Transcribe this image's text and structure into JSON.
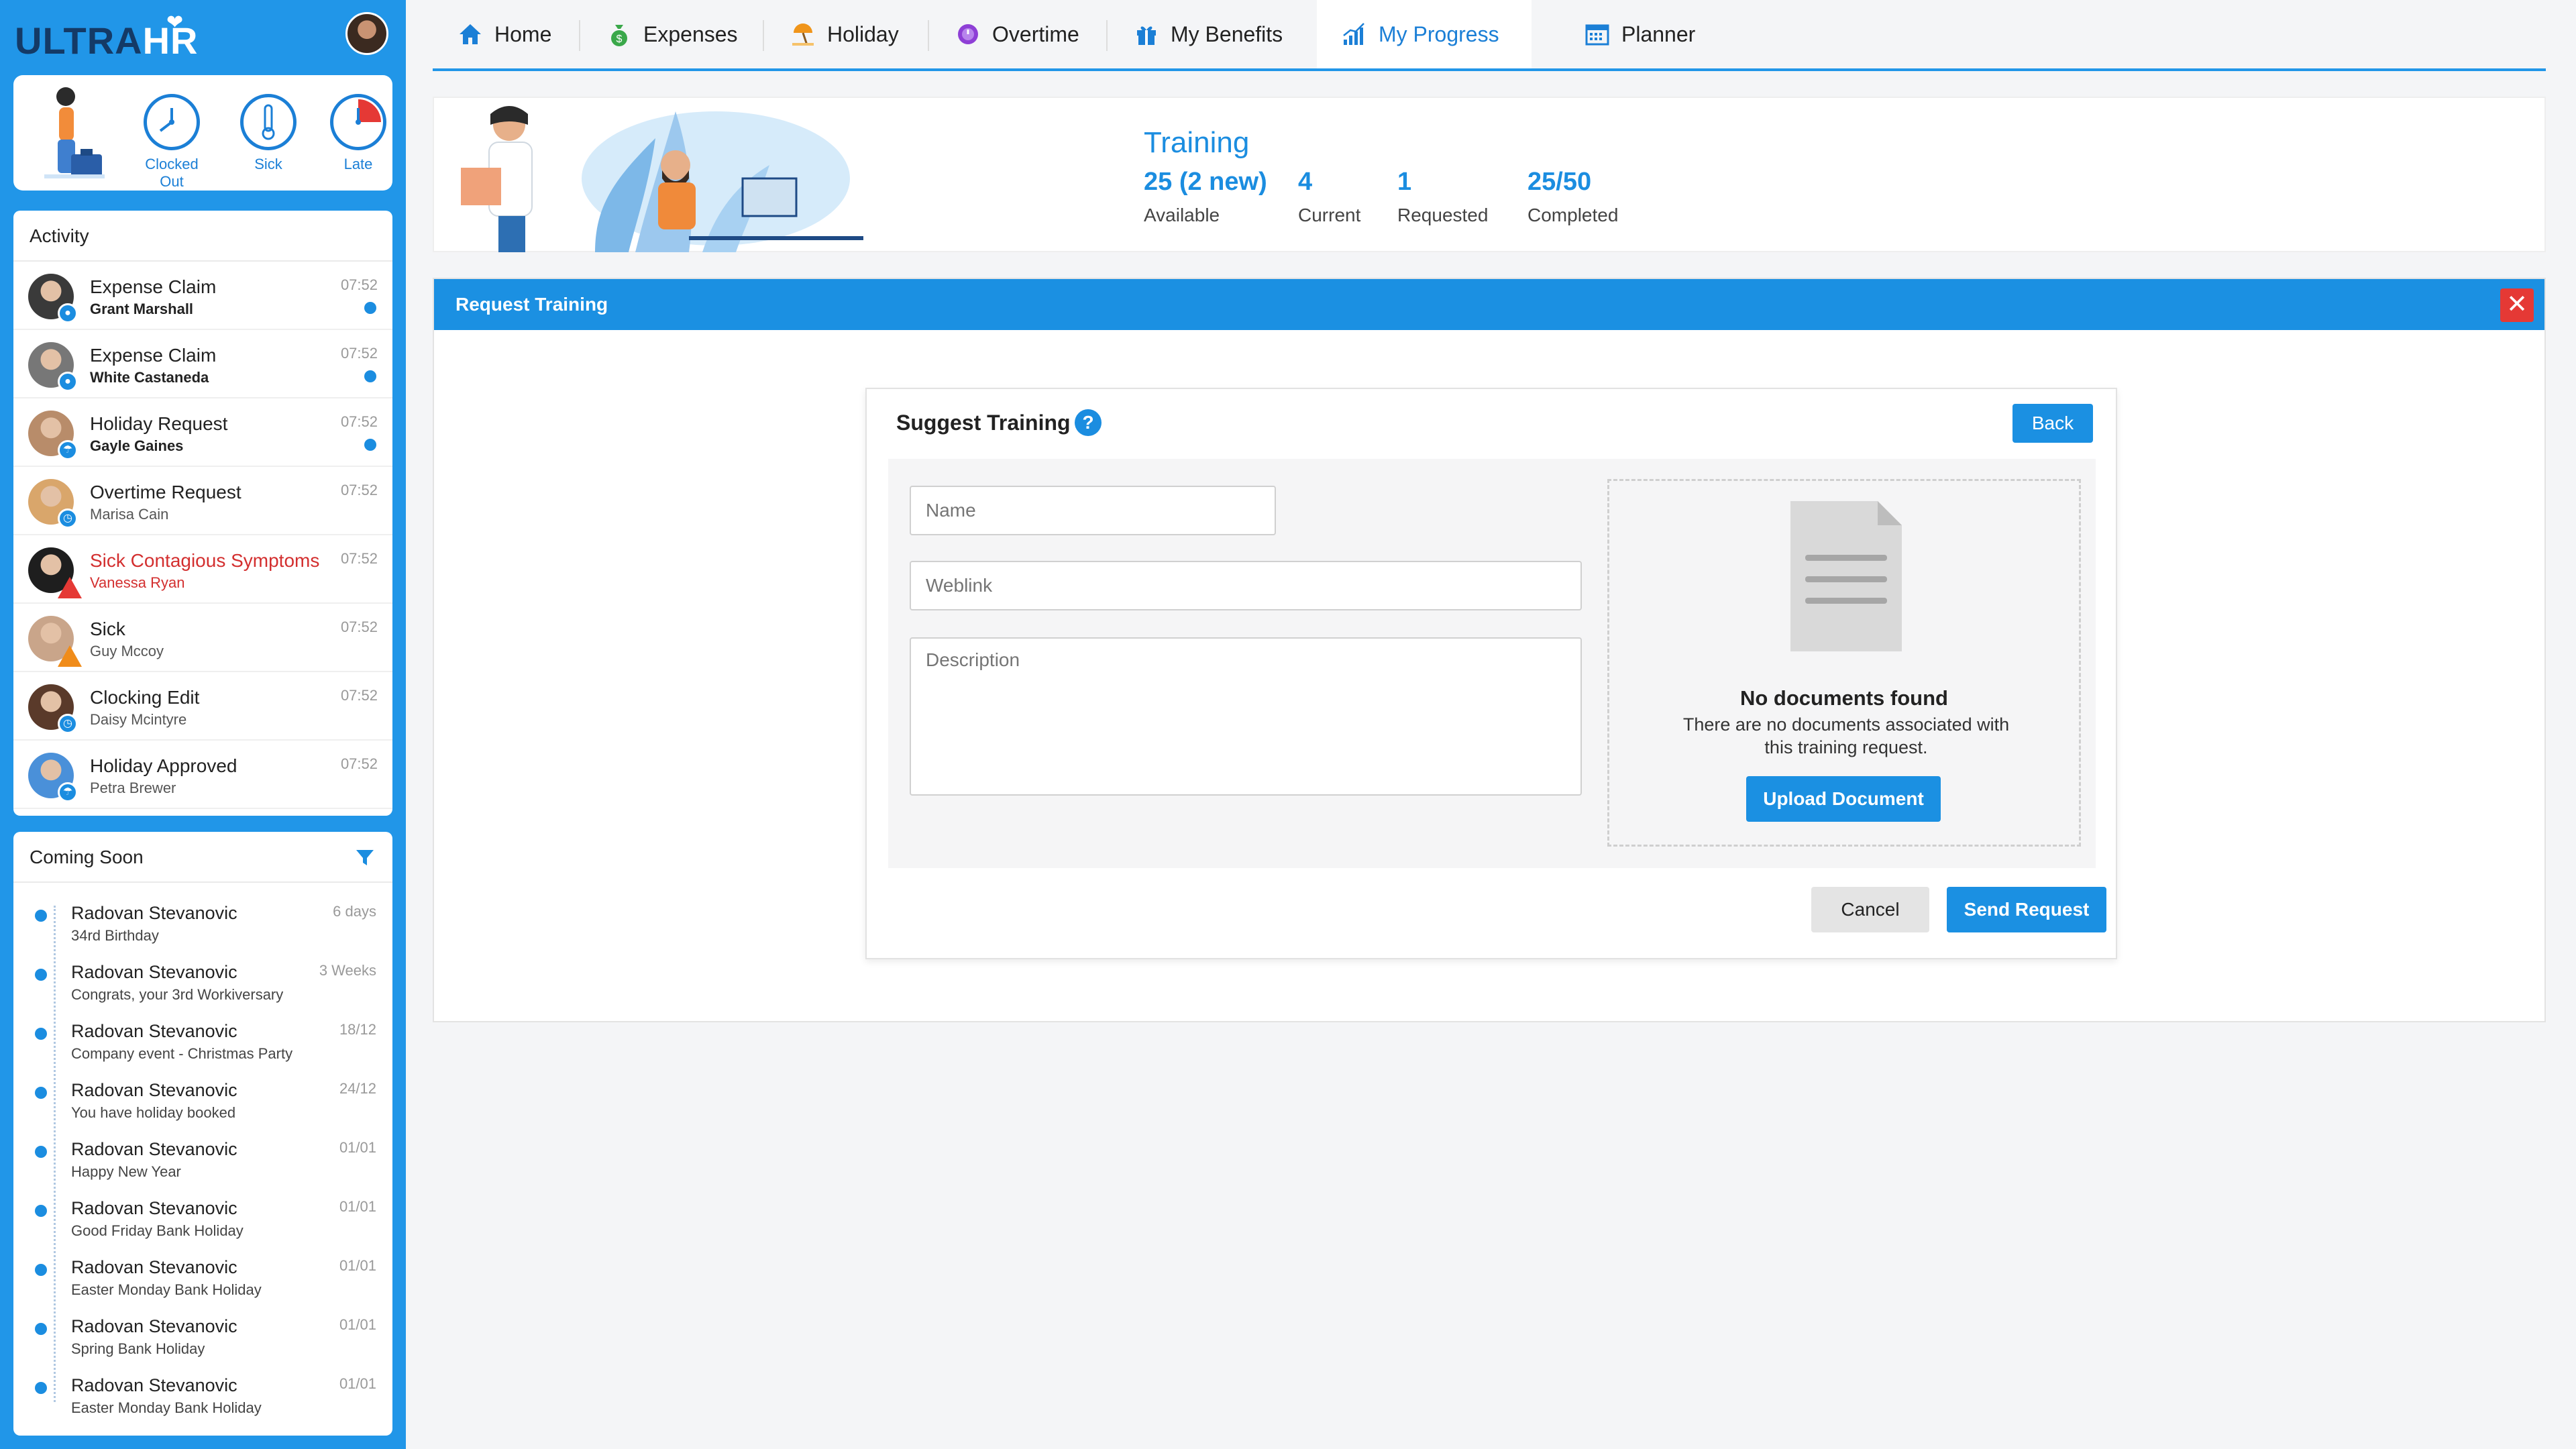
{
  "brand": {
    "ultra": "ULTRA",
    "hr": "HR"
  },
  "status": {
    "clocked_out": "Clocked Out",
    "sick": "Sick",
    "late": "Late"
  },
  "activity": {
    "title": "Activity",
    "items": [
      {
        "title": "Expense Claim",
        "person": "Grant Marshall",
        "time": "07:52",
        "unread": true,
        "badge": "expense-icon",
        "avatar_color": "#3a3a3a",
        "bold_sub": true
      },
      {
        "title": "Expense Claim",
        "person": "White Castaneda",
        "time": "07:52",
        "unread": true,
        "badge": "expense-icon",
        "avatar_color": "#777777",
        "bold_sub": true
      },
      {
        "title": "Holiday Request",
        "person": "Gayle Gaines",
        "time": "07:52",
        "unread": true,
        "badge": "holiday-icon",
        "avatar_color": "#b88c6a",
        "bold_sub": true
      },
      {
        "title": "Overtime Request",
        "person": "Marisa Cain",
        "time": "07:52",
        "unread": false,
        "badge": "clock-icon",
        "avatar_color": "#d9a66b",
        "bold_sub": false
      },
      {
        "title": "Sick Contagious Symptoms",
        "person": "Vanessa Ryan",
        "time": "07:52",
        "unread": false,
        "badge": "warning-icon",
        "avatar_color": "#1e1e1e",
        "bold_sub": false,
        "alert": true
      },
      {
        "title": "Sick",
        "person": "Guy Mccoy",
        "time": "07:52",
        "unread": false,
        "badge": "warning-icon",
        "avatar_color": "#c9a58a",
        "bold_sub": false
      },
      {
        "title": "Clocking Edit",
        "person": "Daisy Mcintyre",
        "time": "07:52",
        "unread": false,
        "badge": "clock-icon",
        "avatar_color": "#5a3a2a",
        "bold_sub": false
      },
      {
        "title": "Holiday Approved",
        "person": "Petra Brewer",
        "time": "07:52",
        "unread": false,
        "badge": "holiday-icon",
        "avatar_color": "#4a90d9",
        "bold_sub": false
      }
    ]
  },
  "coming_soon": {
    "title": "Coming Soon",
    "items": [
      {
        "name": "Radovan Stevanovic",
        "detail": "34rd Birthday",
        "when": "6 days"
      },
      {
        "name": "Radovan Stevanovic",
        "detail": "Congrats, your 3rd Workiversary",
        "when": "3 Weeks"
      },
      {
        "name": "Radovan Stevanovic",
        "detail": "Company event - Christmas Party",
        "when": "18/12"
      },
      {
        "name": "Radovan Stevanovic",
        "detail": "You have holiday booked",
        "when": "24/12"
      },
      {
        "name": "Radovan Stevanovic",
        "detail": "Happy New Year",
        "when": "01/01"
      },
      {
        "name": "Radovan Stevanovic",
        "detail": "Good Friday Bank Holiday",
        "when": "01/01"
      },
      {
        "name": "Radovan Stevanovic",
        "detail": "Easter Monday Bank Holiday",
        "when": "01/01"
      },
      {
        "name": "Radovan Stevanovic",
        "detail": "Spring Bank Holiday",
        "when": "01/01"
      },
      {
        "name": "Radovan Stevanovic",
        "detail": "Easter Monday Bank Holiday",
        "when": "01/01"
      }
    ]
  },
  "nav": {
    "tabs": [
      {
        "label": "Home",
        "icon": "home-icon",
        "active": false
      },
      {
        "label": "Expenses",
        "icon": "money-bag-icon",
        "active": false
      },
      {
        "label": "Holiday",
        "icon": "beach-icon",
        "active": false
      },
      {
        "label": "Overtime",
        "icon": "overtime-clock-icon",
        "active": false
      },
      {
        "label": "My Benefits",
        "icon": "gift-icon",
        "active": false
      },
      {
        "label": "My Progress",
        "icon": "chart-icon",
        "active": true
      },
      {
        "label": "Planner",
        "icon": "calendar-icon",
        "active": false
      }
    ]
  },
  "training": {
    "title": "Training",
    "stats": [
      {
        "value": "25 (2 new)",
        "label": "Available"
      },
      {
        "value": "4",
        "label": "Current"
      },
      {
        "value": "1",
        "label": "Requested"
      },
      {
        "value": "25/50",
        "label": "Completed"
      }
    ]
  },
  "request": {
    "header": "Request Training",
    "close": "✕",
    "suggest_title": "Suggest Training",
    "help": "?",
    "back": "Back",
    "name_placeholder": "Name",
    "weblink_placeholder": "Weblink",
    "description_placeholder": "Description",
    "docs_title": "No documents found",
    "docs_text": "There are no documents associated with this training request.",
    "upload": "Upload Document",
    "cancel": "Cancel",
    "send": "Send Request"
  },
  "colors": {
    "primary": "#1b90e2",
    "sidebar": "#2196e8",
    "danger": "#e53935",
    "alert_text": "#d32f2f"
  }
}
